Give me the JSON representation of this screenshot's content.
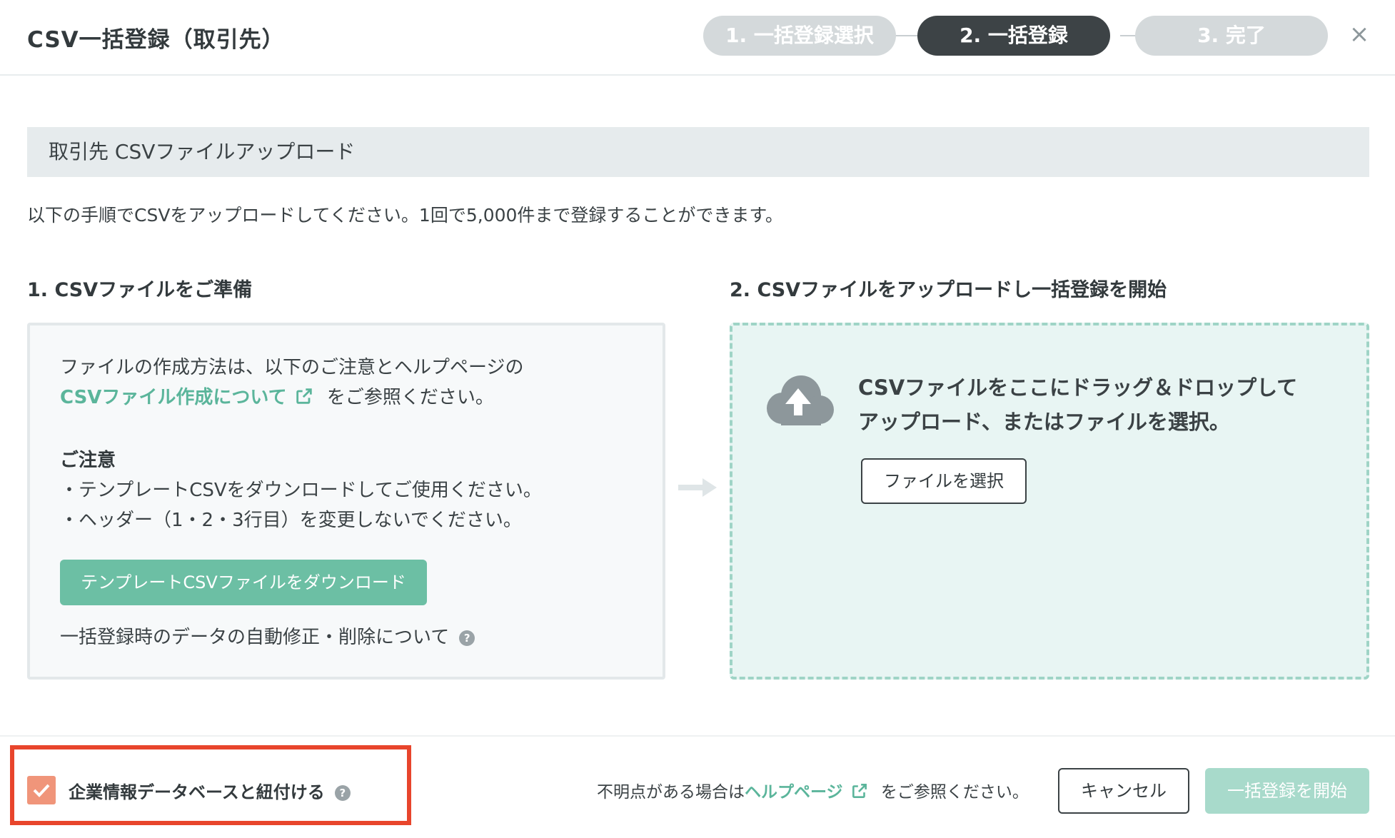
{
  "header": {
    "title": "CSV一括登録（取引先）",
    "steps": [
      {
        "label": "1. 一括登録選択",
        "state": "inactive"
      },
      {
        "label": "2. 一括登録",
        "state": "active"
      },
      {
        "label": "3. 完了",
        "state": "inactive"
      }
    ],
    "close_icon": "close-icon"
  },
  "section": {
    "title": "取引先 CSVファイルアップロード",
    "intro": "以下の手順でCSVをアップロードしてください。1回で5,000件まで登録することができます。"
  },
  "step1": {
    "heading": "1. CSVファイルをご準備",
    "line1": "ファイルの作成方法は、以下のご注意とヘルプページの",
    "link": "CSVファイル作成について",
    "line2_suffix": "をご参照ください。",
    "note_title": "ご注意",
    "note_item1": "・テンプレートCSVをダウンロードしてご使用ください。",
    "note_item2": "・ヘッダー（1・2・3行目）を変更しないでください。",
    "download_button": "テンプレートCSVファイルをダウンロード",
    "auto_fix": "一括登録時のデータの自動修正・削除について",
    "help_mark": "?"
  },
  "step2": {
    "heading": "2. CSVファイルをアップロードし一括登録を開始",
    "drop_line1": "CSVファイルをここにドラッグ＆ドロップして",
    "drop_line2": "アップロード、またはファイルを選択。",
    "select_button": "ファイルを選択"
  },
  "footer": {
    "checkbox_label": "企業情報データベースと紐付ける",
    "checkbox_checked": true,
    "help_prefix": "不明点がある場合は",
    "help_link": "ヘルプページ",
    "help_suffix": "をご参照ください。",
    "cancel_button": "キャンセル",
    "start_button": "一括登録を開始",
    "help_mark": "?"
  },
  "colors": {
    "accent": "#6cbfa4",
    "active_step": "#3d4346",
    "inactive_step": "#d4d9db",
    "highlight": "#e8452c",
    "checkbox": "#f0957a"
  }
}
